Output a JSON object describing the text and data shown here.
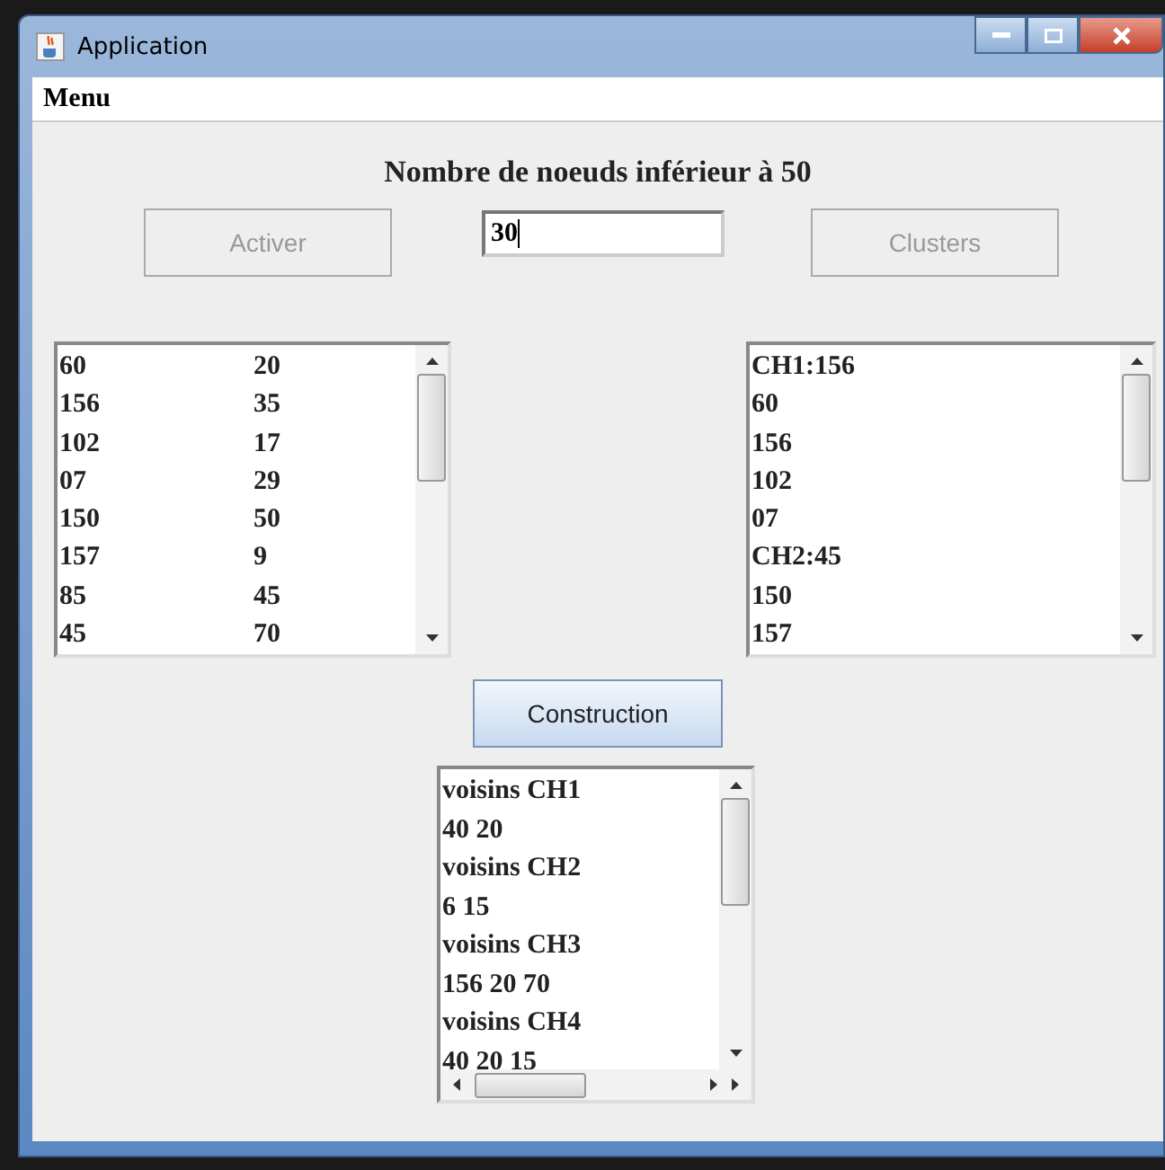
{
  "window": {
    "title": "Application"
  },
  "menu": [
    "Menu"
  ],
  "heading": "Nombre de noeuds inférieur à 50",
  "buttons": [
    {
      "label": "Activer",
      "disabled": true
    },
    {
      "label": "Clusters",
      "disabled": true
    }
  ],
  "input": {
    "value": "30"
  },
  "left_list": [
    [
      "60",
      "20"
    ],
    [
      "156",
      "35"
    ],
    [
      "102",
      "17"
    ],
    [
      "07",
      "29"
    ],
    [
      "150",
      "50"
    ],
    [
      "157",
      "9"
    ],
    [
      "85",
      "45"
    ],
    [
      "45",
      "70"
    ]
  ],
  "right_list": [
    "CH1:156",
    "60",
    "156",
    "102",
    "07",
    "CH2:45",
    "150",
    "157"
  ],
  "construction_button": {
    "label": "Construction",
    "disabled": false
  },
  "bottom_list": [
    "voisins CH1",
    "40 20",
    "voisins CH2",
    "6 15",
    "voisins CH3",
    "156 20 70",
    "voisins CH4",
    "40 20 15"
  ]
}
